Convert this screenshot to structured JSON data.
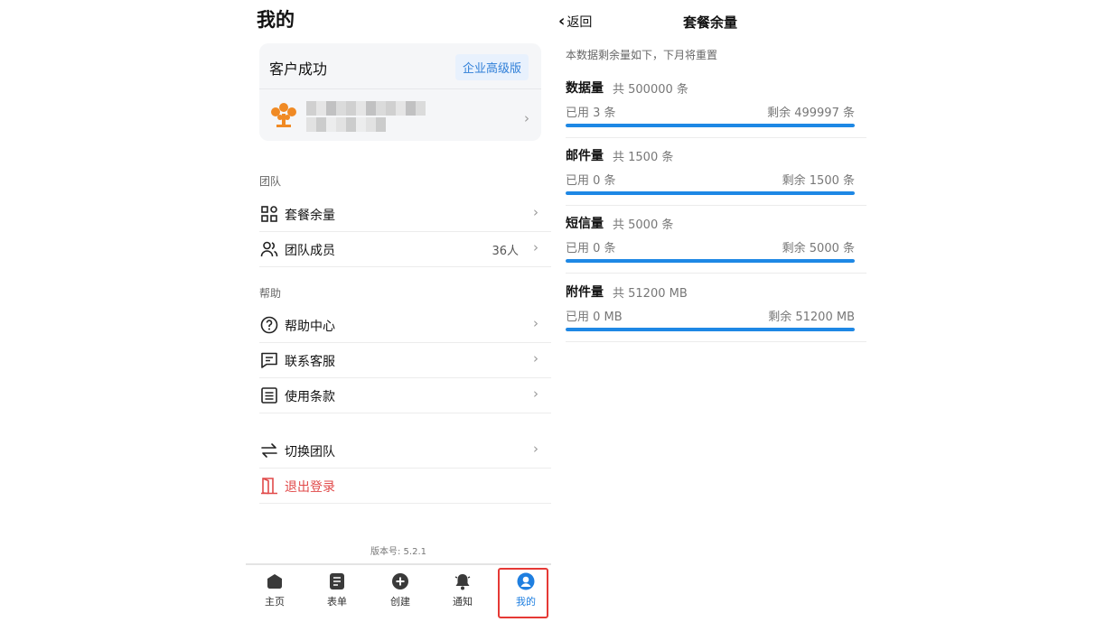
{
  "left": {
    "title": "我的",
    "company": "客户成功",
    "plan": "企业高级版",
    "sections": {
      "team": "团队",
      "help": "帮助"
    },
    "menu": {
      "package": "套餐余量",
      "members": "团队成员",
      "members_count": "36人",
      "help_center": "帮助中心",
      "support": "联系客服",
      "terms": "使用条款",
      "switch_team": "切换团队",
      "logout": "退出登录"
    },
    "version": "版本号: 5.2.1",
    "tabs": [
      "主页",
      "表单",
      "创建",
      "通知",
      "我的"
    ],
    "active_tab": "我的",
    "colors": {
      "accent": "#1f7fe0",
      "logout": "#e14a4a",
      "logo": "#f08a24",
      "highlight": "#e53935"
    }
  },
  "right": {
    "back": "返回",
    "title": "套餐余量",
    "note": "本数据剩余量如下，下月将重置",
    "quotas": [
      {
        "name": "数据量",
        "total": "共 500000 条",
        "used": "已用 3 条",
        "remaining": "剩余 499997 条",
        "remaining_fraction": 0.99999
      },
      {
        "name": "邮件量",
        "total": "共 1500 条",
        "used": "已用 0 条",
        "remaining": "剩余 1500 条",
        "remaining_fraction": 1.0
      },
      {
        "name": "短信量",
        "total": "共 5000 条",
        "used": "已用 0 条",
        "remaining": "剩余 5000 条",
        "remaining_fraction": 1.0
      },
      {
        "name": "附件量",
        "total": "共 51200 MB",
        "used": "已用 0 MB",
        "remaining": "剩余 51200 MB",
        "remaining_fraction": 1.0
      }
    ],
    "bar_color": "#1e88e5"
  }
}
